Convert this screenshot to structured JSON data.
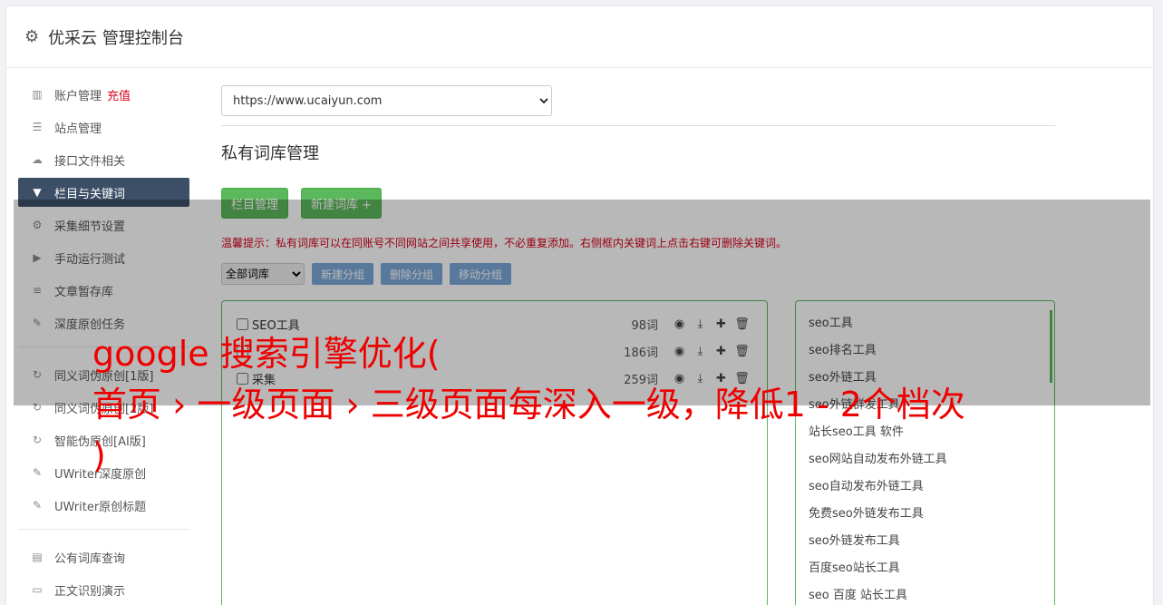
{
  "header": {
    "title": "优采云 管理控制台",
    "icon": "gear-icon"
  },
  "sidebar": {
    "group1": [
      {
        "label": "账户管理",
        "badge": "充值",
        "icon": "bar-chart-icon",
        "glyph": "▥"
      },
      {
        "label": "站点管理",
        "icon": "server-icon",
        "glyph": "☰"
      },
      {
        "label": "接口文件相关",
        "icon": "cloud-upload-icon",
        "glyph": "☁"
      },
      {
        "label": "栏目与关键词",
        "icon": "filter-icon",
        "glyph": "▼",
        "active": true
      },
      {
        "label": "采集细节设置",
        "icon": "gears-icon",
        "glyph": "⚙"
      },
      {
        "label": "手动运行测试",
        "icon": "play-circle-icon",
        "glyph": "▶"
      },
      {
        "label": "文章暂存库",
        "icon": "database-icon",
        "glyph": "≡"
      },
      {
        "label": "深度原创任务",
        "icon": "edit-icon",
        "glyph": "✎"
      }
    ],
    "group2": [
      {
        "label": "同义词伪原创[1版]",
        "icon": "refresh-icon",
        "glyph": "↻"
      },
      {
        "label": "同义词伪原创[2版]",
        "icon": "refresh-icon",
        "glyph": "↻"
      },
      {
        "label": "智能伪原创[AI版]",
        "icon": "refresh-icon",
        "glyph": "↻"
      },
      {
        "label": "UWriter深度原创",
        "icon": "edit-icon",
        "glyph": "✎"
      },
      {
        "label": "UWriter原创标题",
        "icon": "edit-icon",
        "glyph": "✎"
      }
    ],
    "group3": [
      {
        "label": "公有词库查询",
        "icon": "book-icon",
        "glyph": "▤"
      },
      {
        "label": "正文识别演示",
        "icon": "monitor-icon",
        "glyph": "▭"
      }
    ]
  },
  "main": {
    "site_select": "https://www.ucaiyun.com",
    "section_title": "私有词库管理",
    "btn_column": "栏目管理",
    "btn_new_lib": "新建词库 +",
    "tip": "温馨提示：私有词库可以在同账号不同网站之间共享使用，不必重复添加。右侧框内关键词上点击右键可删除关键词。",
    "group_select": "全部词库",
    "btn_new_group": "新建分组",
    "btn_del_group": "删除分组",
    "btn_move_group": "移动分组",
    "libraries": [
      {
        "name": "SEO工具",
        "count": "98词"
      },
      {
        "name": "",
        "count": "186词"
      },
      {
        "name": "采集",
        "count": "259词"
      }
    ],
    "keywords": [
      "seo工具",
      "seo排名工具",
      "seo外链工具",
      "seo外链群发工具",
      "站长seo工具 软件",
      "seo网站自动发布外链工具",
      "seo自动发布外链工具",
      "免费seo外链发布工具",
      "seo外链发布工具",
      "百度seo站长工具",
      "seo 百度 站长工具"
    ]
  },
  "overlay": {
    "line1": "google 搜索引擎优化(",
    "line2": "首页 › 一级页面 › 三级页面每深入一级，降低1 - 2个档次",
    "line3": ")"
  }
}
